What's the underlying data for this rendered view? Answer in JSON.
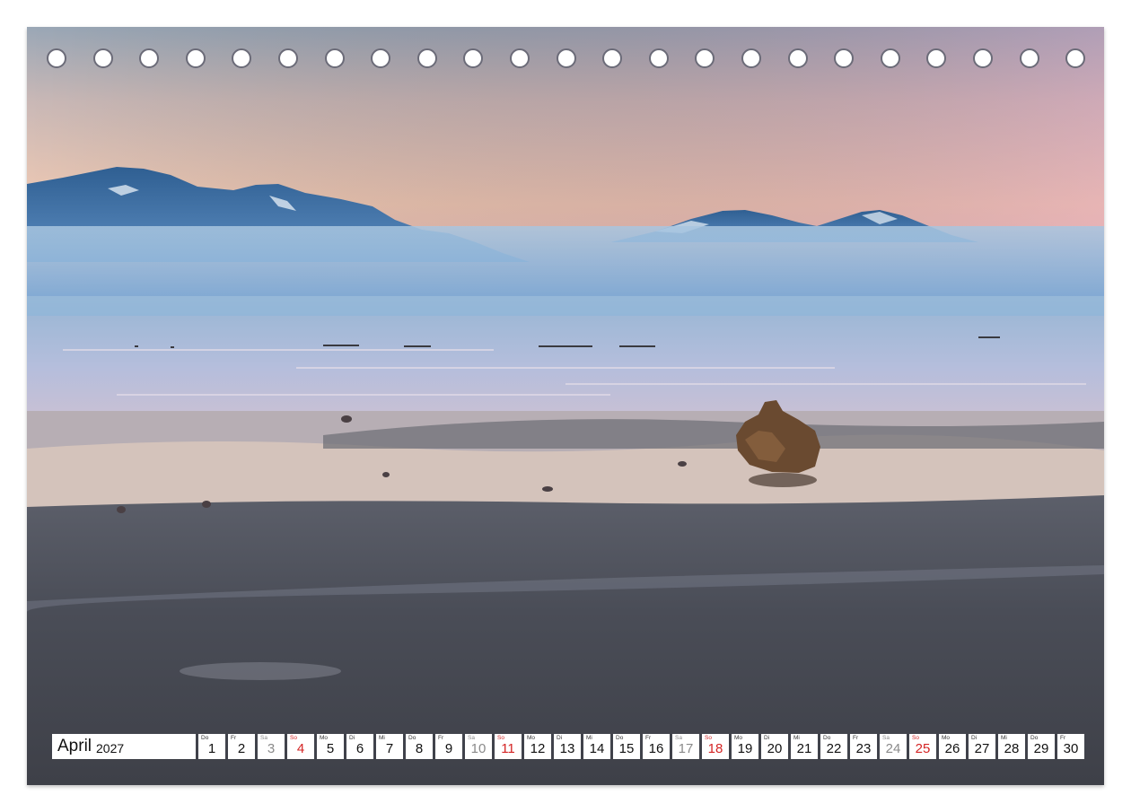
{
  "calendar": {
    "month": "April",
    "year": "2027",
    "days": [
      {
        "wd": "Do",
        "num": "1",
        "type": "weekday"
      },
      {
        "wd": "Fr",
        "num": "2",
        "type": "weekday"
      },
      {
        "wd": "Sa",
        "num": "3",
        "type": "sat"
      },
      {
        "wd": "So",
        "num": "4",
        "type": "sun"
      },
      {
        "wd": "Mo",
        "num": "5",
        "type": "weekday"
      },
      {
        "wd": "Di",
        "num": "6",
        "type": "weekday"
      },
      {
        "wd": "Mi",
        "num": "7",
        "type": "weekday"
      },
      {
        "wd": "Do",
        "num": "8",
        "type": "weekday"
      },
      {
        "wd": "Fr",
        "num": "9",
        "type": "weekday"
      },
      {
        "wd": "Sa",
        "num": "10",
        "type": "sat"
      },
      {
        "wd": "So",
        "num": "11",
        "type": "sun"
      },
      {
        "wd": "Mo",
        "num": "12",
        "type": "weekday"
      },
      {
        "wd": "Di",
        "num": "13",
        "type": "weekday"
      },
      {
        "wd": "Mi",
        "num": "14",
        "type": "weekday"
      },
      {
        "wd": "Do",
        "num": "15",
        "type": "weekday"
      },
      {
        "wd": "Fr",
        "num": "16",
        "type": "weekday"
      },
      {
        "wd": "Sa",
        "num": "17",
        "type": "sat"
      },
      {
        "wd": "So",
        "num": "18",
        "type": "sun"
      },
      {
        "wd": "Mo",
        "num": "19",
        "type": "weekday"
      },
      {
        "wd": "Di",
        "num": "20",
        "type": "weekday"
      },
      {
        "wd": "Mi",
        "num": "21",
        "type": "weekday"
      },
      {
        "wd": "Do",
        "num": "22",
        "type": "weekday"
      },
      {
        "wd": "Fr",
        "num": "23",
        "type": "weekday"
      },
      {
        "wd": "Sa",
        "num": "24",
        "type": "sat"
      },
      {
        "wd": "So",
        "num": "25",
        "type": "sun"
      },
      {
        "wd": "Mo",
        "num": "26",
        "type": "weekday"
      },
      {
        "wd": "Di",
        "num": "27",
        "type": "weekday"
      },
      {
        "wd": "Mi",
        "num": "28",
        "type": "weekday"
      },
      {
        "wd": "Do",
        "num": "29",
        "type": "weekday"
      },
      {
        "wd": "Fr",
        "num": "30",
        "type": "weekday"
      }
    ]
  },
  "colors": {
    "sunday": "#d42424",
    "saturday": "#8a8a8a"
  }
}
